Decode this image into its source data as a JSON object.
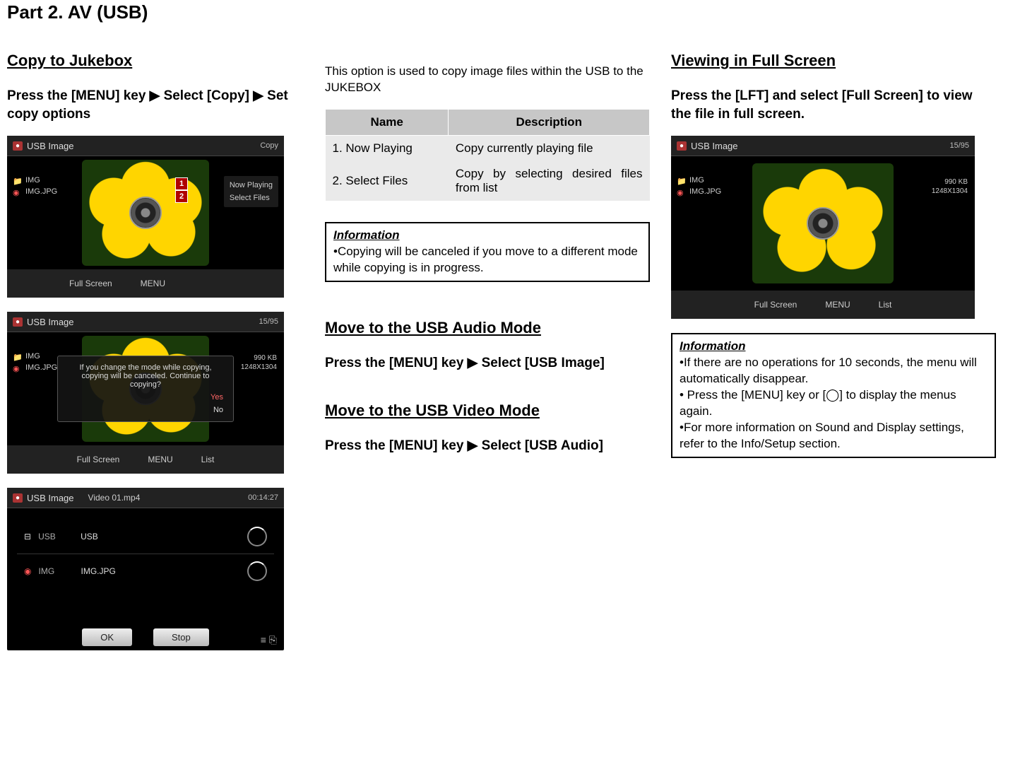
{
  "page": {
    "part_title": "Part 2. AV (USB)"
  },
  "copy": {
    "heading": "Copy to Jukebox",
    "instruction": "Press the [MENU] key ▶ Select [Copy] ▶ Set copy options"
  },
  "screenshots": {
    "ss1": {
      "title": "USB Image",
      "hdr_right": "Copy",
      "folder": "IMG",
      "file": "IMG.JPG",
      "menu1": "Now Playing",
      "menu2": "Select Files",
      "marker1": "1",
      "marker2": "2",
      "foot_left": "Full Screen",
      "foot_mid": "MENU"
    },
    "ss2": {
      "title": "USB Image",
      "counter": "15/95",
      "folder": "IMG",
      "file": "IMG.JPG",
      "size": "990 KB",
      "dims": "1248X1304",
      "dialog": "If you change the mode while copying, copying will be canceled. Continue to copying?",
      "opt_yes": "Yes",
      "opt_no": "No",
      "foot_left": "Full Screen",
      "foot_mid": "MENU",
      "foot_right": "List"
    },
    "ss3": {
      "title": "USB Image",
      "hdr_mid": "Video 01.mp4",
      "hdr_right": "00:14:27",
      "row_usb_label": "USB",
      "row_usb_name": "USB",
      "row_img_label": "IMG",
      "row_img_name": "IMG.JPG",
      "btn_ok": "OK",
      "btn_stop": "Stop"
    },
    "ss4": {
      "title": "USB Image",
      "counter": "15/95",
      "folder": "IMG",
      "file": "IMG.JPG",
      "size": "990 KB",
      "dims": "1248X1304",
      "foot_left": "Full Screen",
      "foot_mid": "MENU",
      "foot_right": "List"
    }
  },
  "col2": {
    "intro": "This option is used to copy image files within the USB to the JUKEBOX",
    "table": {
      "h_name": "Name",
      "h_desc": "Description",
      "r1_name": "1. Now Playing",
      "r1_desc": "Copy currently playing file",
      "r2_name": "2. Select Files",
      "r2_desc": "Copy by selecting desired files from list"
    },
    "info1_title": "Information",
    "info1_body": "•Copying will be canceled if you move to a different mode while copying is in progress.",
    "audio_heading": "Move to the USB Audio Mode",
    "audio_instr": "Press the [MENU] key ▶ Select [USB Image]",
    "video_heading": "Move to the USB Video Mode",
    "video_instr": "Press the [MENU] key ▶ Select [USB Audio]"
  },
  "col3": {
    "heading": "Viewing in Full Screen",
    "instr": "Press the [LFT] and select [Full Screen] to view the file in full screen.",
    "info_title": "Information",
    "info_l1": "•If there are no operations for 10 seconds, the menu will automatically disappear.",
    "info_l2": "• Press the [MENU] key or [◯] to display the menus again.",
    "info_l3": "•For more information on Sound and Display settings, refer to the Info/Setup section."
  }
}
